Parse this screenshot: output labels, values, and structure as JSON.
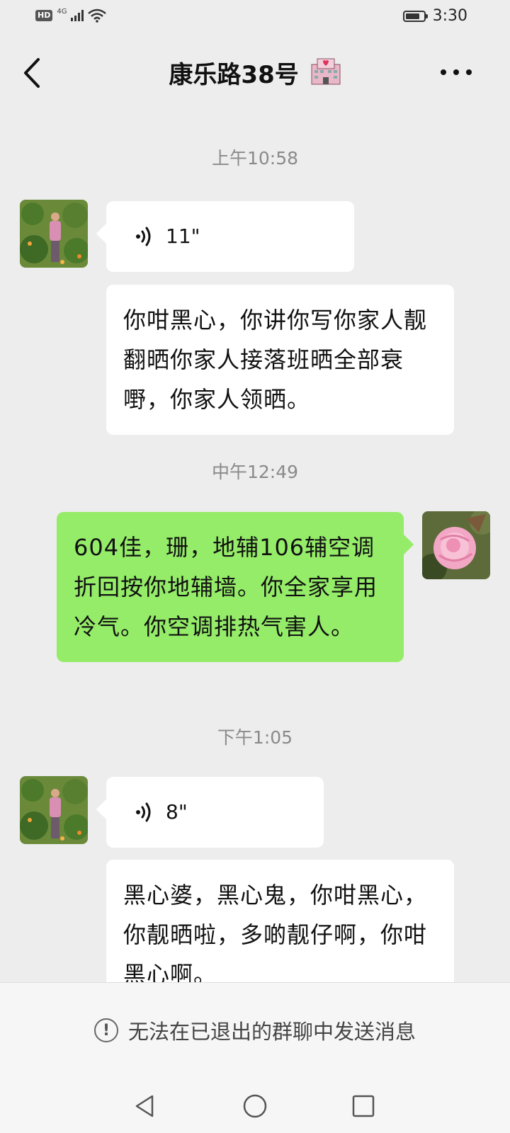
{
  "status_bar": {
    "network_badge": "HD",
    "network_type": "4G",
    "time": "3:30",
    "battery_level": 0.8
  },
  "header": {
    "title": "康乐路38号"
  },
  "messages": [
    {
      "timestamp": "上午10:58"
    },
    {
      "voice_duration": "11\""
    },
    {
      "text": "你咁黑心，你讲你写你家人靓翻晒你家人接落班晒全部衰嘢，你家人领晒。"
    },
    {
      "timestamp": "中午12:49"
    },
    {
      "text": "604佳，珊，地辅106辅空调折回按你地辅墙。你全家享用冷气。你空调排热气害人。"
    },
    {
      "timestamp": "下午1:05"
    },
    {
      "voice_duration": "8\""
    },
    {
      "text": "黑心婆，黑心鬼，你咁黑心，你靓晒啦，多啲靓仔啊，你咁黑心啊。"
    }
  ],
  "notice": {
    "text": "无法在已退出的群聊中发送消息",
    "icon": "!"
  },
  "icons": {
    "back": "chevron-left",
    "more": "more-dots",
    "voice": "voice-wave",
    "nav": [
      "back-triangle",
      "home-circle",
      "recents-square"
    ]
  }
}
